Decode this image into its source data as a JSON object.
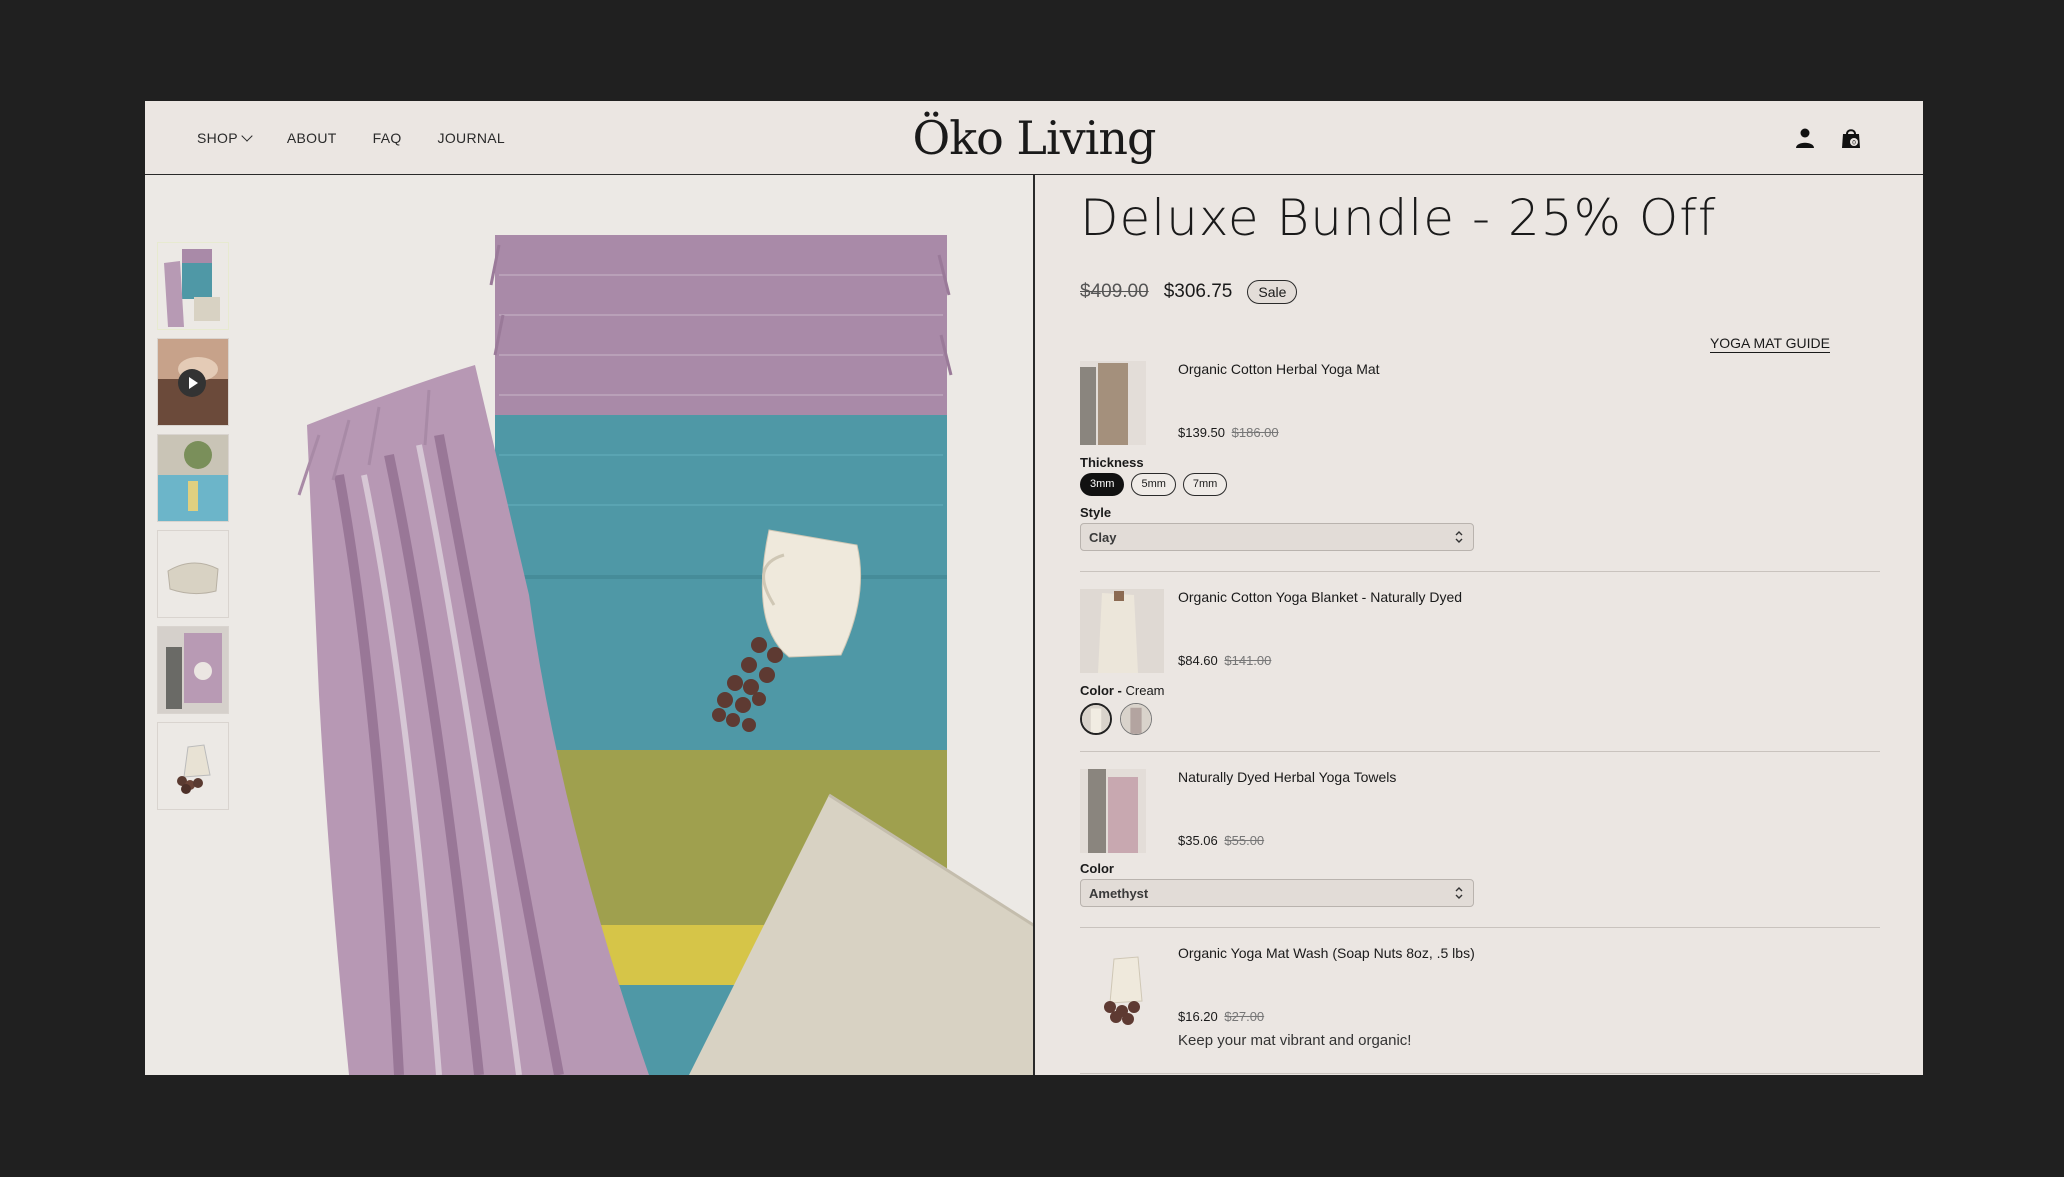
{
  "header": {
    "nav": [
      {
        "label": "SHOP"
      },
      {
        "label": "ABOUT"
      },
      {
        "label": "FAQ"
      },
      {
        "label": "JOURNAL"
      }
    ],
    "logo": "Öko Living",
    "cart_count": "0"
  },
  "product": {
    "title": "Deluxe Bundle - 25% Off",
    "old_price": "$409.00",
    "price": "$306.75",
    "badge": "Sale",
    "guide_link": "YOGA MAT GUIDE"
  },
  "bundle_items": [
    {
      "name": "Organic Cotton Herbal Yoga Mat",
      "price": "$139.50",
      "was": "$186.00",
      "option1_label": "Thickness",
      "thickness_options": [
        "3mm",
        "5mm",
        "7mm"
      ],
      "thickness_selected": "3mm",
      "option2_label": "Style",
      "style_value": "Clay"
    },
    {
      "name": "Organic Cotton Yoga Blanket - Naturally Dyed",
      "price": "$84.60",
      "was": "$141.00",
      "option_label": "Color - ",
      "option_value": "Cream"
    },
    {
      "name": "Naturally Dyed Herbal Yoga Towels",
      "price": "$35.06",
      "was": "$55.00",
      "option_label": "Color",
      "option_value": "Amethyst"
    },
    {
      "name": "Organic Yoga Mat Wash (Soap Nuts 8oz, .5 lbs)",
      "price": "$16.20",
      "was": "$27.00",
      "description": "Keep your mat vibrant and organic!"
    }
  ],
  "colors": {
    "backdrop": "#202020",
    "page": "#ebe6e2",
    "mat_purple": "#a98aa8",
    "mat_teal": "#4f98a6",
    "mat_olive": "#9fa04e",
    "blanket": "#d8d2c3"
  }
}
